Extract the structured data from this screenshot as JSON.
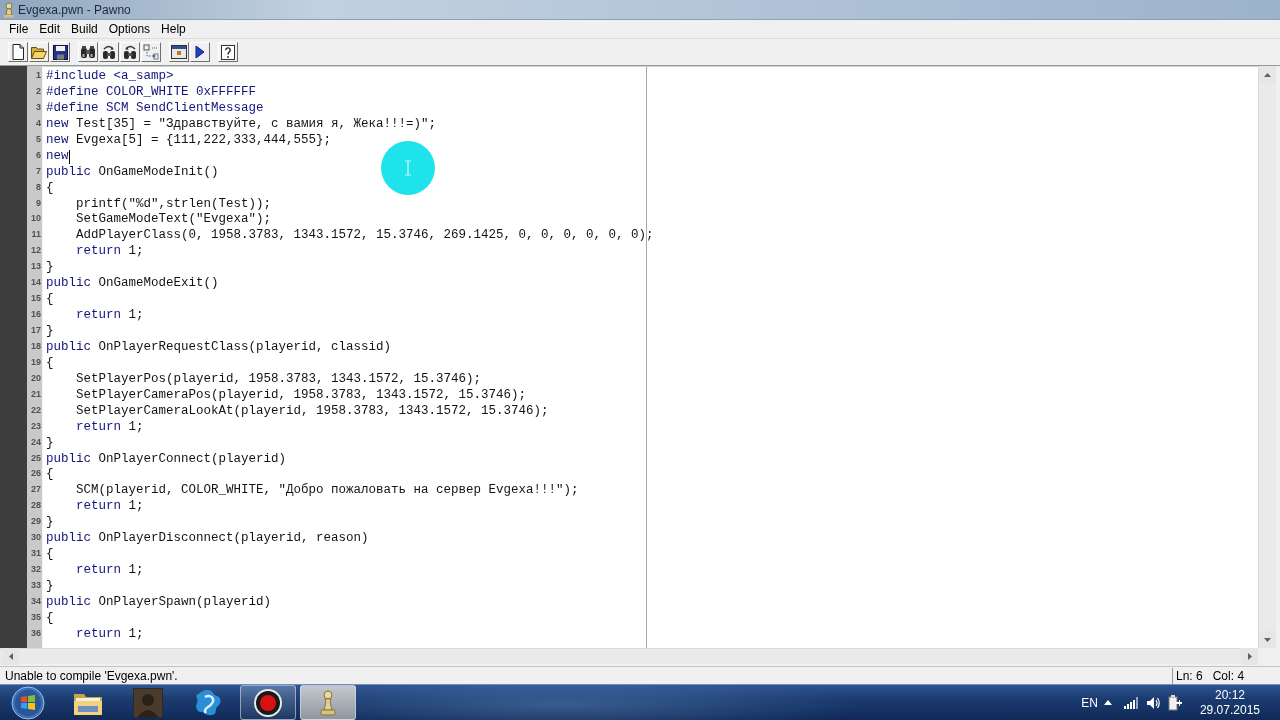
{
  "window": {
    "title": "Evgexa.pwn - Pawno"
  },
  "menu": [
    "File",
    "Edit",
    "Build",
    "Options",
    "Help"
  ],
  "editor": {
    "lines": [
      {
        "number": "1",
        "caret": false,
        "parts": [
          {
            "kind": "keyword",
            "text": "#include <a_samp>"
          }
        ]
      },
      {
        "number": "2",
        "caret": false,
        "parts": [
          {
            "kind": "keyword",
            "text": "#define COLOR_WHITE 0xFFFFFF"
          }
        ]
      },
      {
        "number": "3",
        "caret": false,
        "parts": [
          {
            "kind": "keyword",
            "text": "#define SCM SendClientMessage"
          }
        ]
      },
      {
        "number": "4",
        "caret": false,
        "parts": [
          {
            "kind": "keyword",
            "text": "new"
          },
          {
            "kind": "plain",
            "text": " Test[35] = \"Здравствуйте, с вамия я, Жека!!!=)\";"
          }
        ]
      },
      {
        "number": "5",
        "caret": false,
        "parts": [
          {
            "kind": "keyword",
            "text": "new"
          },
          {
            "kind": "plain",
            "text": " Evgexa[5] = {111,222,333,444,555};"
          }
        ]
      },
      {
        "number": "6",
        "caret": true,
        "parts": [
          {
            "kind": "keyword",
            "text": "new"
          }
        ]
      },
      {
        "number": "7",
        "caret": false,
        "parts": [
          {
            "kind": "keyword",
            "text": "public"
          },
          {
            "kind": "plain",
            "text": " OnGameModeInit()"
          }
        ]
      },
      {
        "number": "8",
        "caret": false,
        "parts": [
          {
            "kind": "plain",
            "text": "{"
          }
        ],
        "children": [
          {
            "number": "9",
            "caret": false,
            "parts": [
              {
                "kind": "plain",
                "text": "printf(\"%d\",strlen(Test));"
              }
            ]
          },
          {
            "number": "10",
            "caret": false,
            "parts": [
              {
                "kind": "plain",
                "text": "SetGameModeText(\"Evgexa\");"
              }
            ]
          },
          {
            "number": "11",
            "caret": false,
            "parts": [
              {
                "kind": "plain",
                "text": "AddPlayerClass(0, 1958.3783, 1343.1572, 15.3746, 269.1425, 0, 0, 0, 0, 0, 0);"
              }
            ]
          },
          {
            "number": "12",
            "caret": false,
            "parts": [
              {
                "kind": "keyword",
                "text": "return"
              },
              {
                "kind": "plain",
                "text": " 1;"
              }
            ]
          }
        ]
      },
      {
        "number": "13",
        "caret": false,
        "parts": [
          {
            "kind": "plain",
            "text": "}"
          }
        ]
      },
      {
        "number": "14",
        "caret": false,
        "parts": [
          {
            "kind": "keyword",
            "text": "public"
          },
          {
            "kind": "plain",
            "text": " OnGameModeExit()"
          }
        ]
      },
      {
        "number": "15",
        "caret": false,
        "parts": [
          {
            "kind": "plain",
            "text": "{"
          }
        ],
        "children": [
          {
            "number": "16",
            "caret": false,
            "parts": [
              {
                "kind": "keyword",
                "text": "return"
              },
              {
                "kind": "plain",
                "text": " 1;"
              }
            ]
          }
        ]
      },
      {
        "number": "17",
        "caret": false,
        "parts": [
          {
            "kind": "plain",
            "text": "}"
          }
        ]
      },
      {
        "number": "18",
        "caret": false,
        "parts": [
          {
            "kind": "keyword",
            "text": "public"
          },
          {
            "kind": "plain",
            "text": " OnPlayerRequestClass(playerid, classid)"
          }
        ]
      },
      {
        "number": "19",
        "caret": false,
        "parts": [
          {
            "kind": "plain",
            "text": "{"
          }
        ],
        "children": [
          {
            "number": "20",
            "caret": false,
            "parts": [
              {
                "kind": "plain",
                "text": "SetPlayerPos(playerid, 1958.3783, 1343.1572, 15.3746);"
              }
            ]
          },
          {
            "number": "21",
            "caret": false,
            "parts": [
              {
                "kind": "plain",
                "text": "SetPlayerCameraPos(playerid, 1958.3783, 1343.1572, 15.3746);"
              }
            ]
          },
          {
            "number": "22",
            "caret": false,
            "parts": [
              {
                "kind": "plain",
                "text": "SetPlayerCameraLookAt(playerid, 1958.3783, 1343.1572, 15.3746);"
              }
            ]
          },
          {
            "number": "23",
            "caret": false,
            "parts": [
              {
                "kind": "keyword",
                "text": "return"
              },
              {
                "kind": "plain",
                "text": " 1;"
              }
            ]
          }
        ]
      },
      {
        "number": "24",
        "caret": false,
        "parts": [
          {
            "kind": "plain",
            "text": "}"
          }
        ]
      },
      {
        "number": "25",
        "caret": false,
        "parts": [
          {
            "kind": "keyword",
            "text": "public"
          },
          {
            "kind": "plain",
            "text": " OnPlayerConnect(playerid)"
          }
        ]
      },
      {
        "number": "26",
        "caret": false,
        "parts": [
          {
            "kind": "plain",
            "text": "{"
          }
        ],
        "children": [
          {
            "number": "27",
            "caret": false,
            "parts": [
              {
                "kind": "plain",
                "text": "SCM(playerid, COLOR_WHITE, \"Добро пожаловать на сервер Evgexa!!!\");"
              }
            ]
          },
          {
            "number": "28",
            "caret": false,
            "parts": [
              {
                "kind": "keyword",
                "text": "return"
              },
              {
                "kind": "plain",
                "text": " 1;"
              }
            ]
          }
        ]
      },
      {
        "number": "29",
        "caret": false,
        "parts": [
          {
            "kind": "plain",
            "text": "}"
          }
        ]
      },
      {
        "number": "30",
        "caret": false,
        "parts": [
          {
            "kind": "keyword",
            "text": "public"
          },
          {
            "kind": "plain",
            "text": " OnPlayerDisconnect(playerid, reason)"
          }
        ]
      },
      {
        "number": "31",
        "caret": false,
        "parts": [
          {
            "kind": "plain",
            "text": "{"
          }
        ],
        "children": [
          {
            "number": "32",
            "caret": false,
            "parts": [
              {
                "kind": "keyword",
                "text": "return"
              },
              {
                "kind": "plain",
                "text": " 1;"
              }
            ]
          }
        ]
      },
      {
        "number": "33",
        "caret": false,
        "parts": [
          {
            "kind": "plain",
            "text": "}"
          }
        ]
      },
      {
        "number": "34",
        "caret": false,
        "parts": [
          {
            "kind": "keyword",
            "text": "public"
          },
          {
            "kind": "plain",
            "text": " OnPlayerSpawn(playerid)"
          }
        ]
      },
      {
        "number": "35",
        "caret": false,
        "parts": [
          {
            "kind": "plain",
            "text": "{"
          }
        ],
        "children": [
          {
            "number": "36",
            "caret": false,
            "parts": [
              {
                "kind": "keyword",
                "text": "return"
              },
              {
                "kind": "plain",
                "text": " 1;"
              }
            ]
          }
        ]
      }
    ]
  },
  "status_bar": {
    "message": "Unable to compile 'Evgexa.pwn'.",
    "line": "Ln: 6",
    "column": "Col: 4"
  },
  "taskbar": {
    "apps": [
      {
        "kind": "folder",
        "open": false,
        "selected": false
      },
      {
        "kind": "avatar",
        "open": false,
        "selected": false
      },
      {
        "kind": "splash",
        "open": false,
        "selected": false
      },
      {
        "kind": "record",
        "open": true,
        "selected": false
      },
      {
        "kind": "pawn",
        "open": true,
        "selected": true
      }
    ],
    "language": "EN",
    "time": "20:12",
    "date": "29.07.2015"
  }
}
